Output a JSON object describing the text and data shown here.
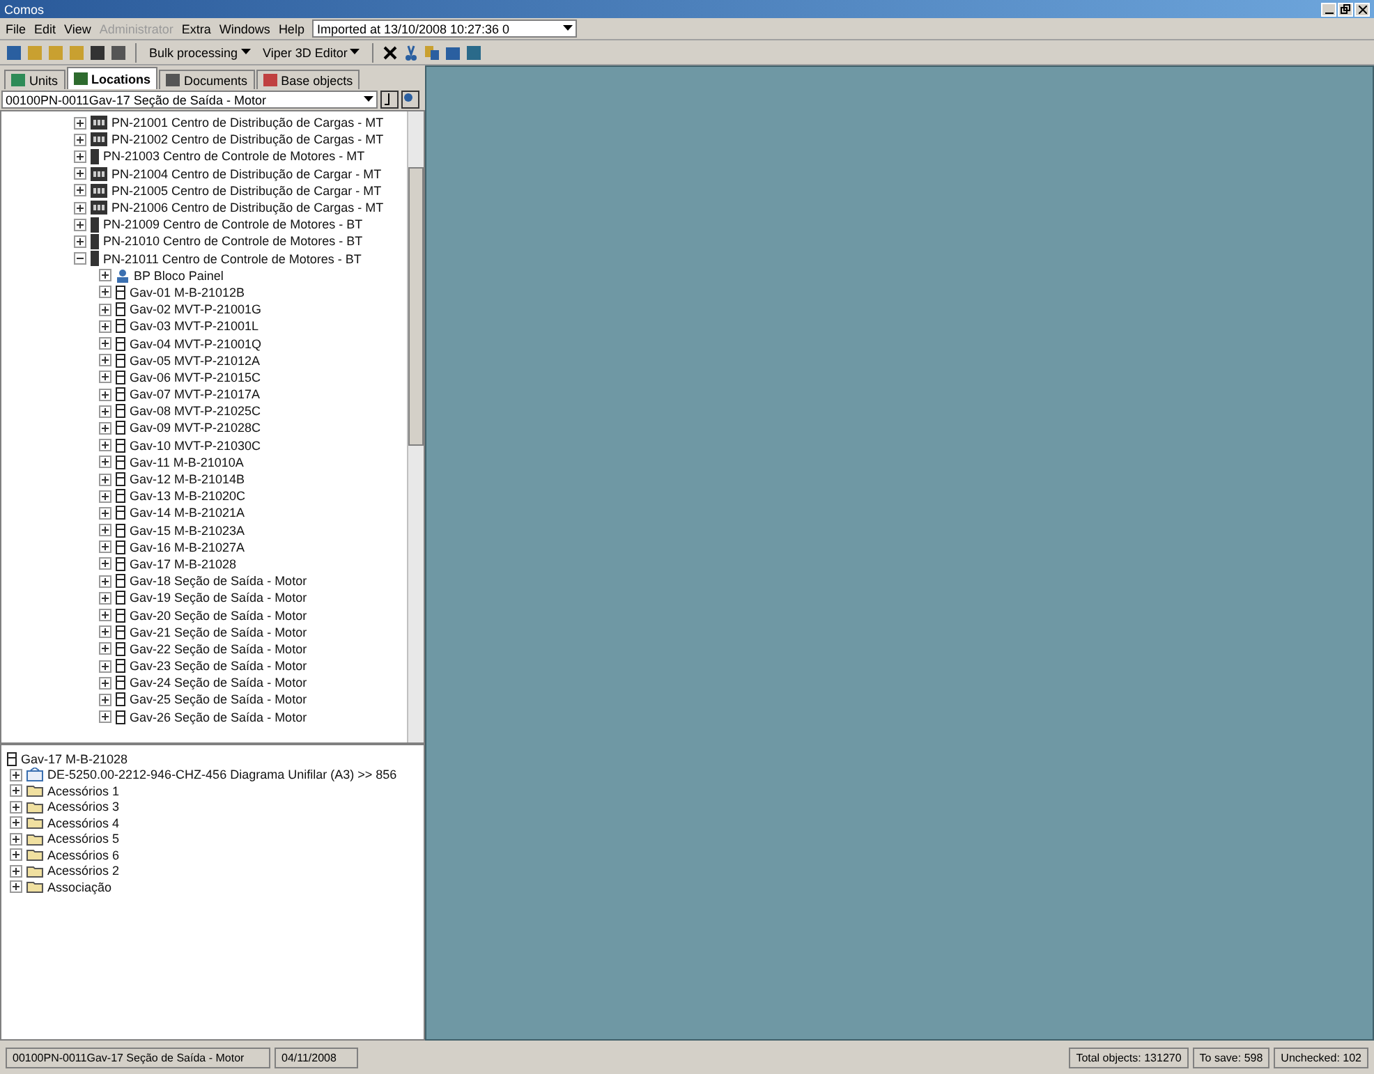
{
  "window": {
    "title": "Comos"
  },
  "menu": [
    {
      "label": "File",
      "disabled": false
    },
    {
      "label": "Edit",
      "disabled": false
    },
    {
      "label": "View",
      "disabled": false
    },
    {
      "label": "Administrator",
      "disabled": true
    },
    {
      "label": "Extra",
      "disabled": false
    },
    {
      "label": "Windows",
      "disabled": false
    },
    {
      "label": "Help",
      "disabled": false
    }
  ],
  "import_selector": {
    "value": "Imported at 13/10/2008 10:27:36  0"
  },
  "toolbar": {
    "buttons": [
      "Bulk processing",
      "Viper 3D Editor"
    ]
  },
  "tabs": [
    {
      "label": "Units",
      "selected": false
    },
    {
      "label": "Locations",
      "selected": true
    },
    {
      "label": "Documents",
      "selected": false
    },
    {
      "label": "Base objects",
      "selected": false
    }
  ],
  "location_selector": {
    "value": "00100PN-0011Gav-17  Seção de Saída - Motor"
  },
  "tree": [
    {
      "kind": "board",
      "label": "PN-21001 Centro de Distribução de Cargas - MT",
      "expanded": false
    },
    {
      "kind": "board",
      "label": "PN-21002 Centro de Distribução de Cargas - MT",
      "expanded": false
    },
    {
      "kind": "cabinet",
      "label": "PN-21003 Centro de Controle de Motores - MT",
      "expanded": false
    },
    {
      "kind": "board",
      "label": "PN-21004 Centro de Distribução de Cargar - MT",
      "expanded": false
    },
    {
      "kind": "board",
      "label": "PN-21005 Centro de Distribução de Cargar - MT",
      "expanded": false
    },
    {
      "kind": "board",
      "label": "PN-21006 Centro de Distribução de Cargas - MT",
      "expanded": false
    },
    {
      "kind": "cabinet",
      "label": "PN-21009 Centro de Controle de Motores - BT",
      "expanded": false
    },
    {
      "kind": "cabinet",
      "label": "PN-21010 Centro de Controle de Motores - BT",
      "expanded": false
    },
    {
      "kind": "cabinet",
      "label": "PN-21011 Centro de Controle de Motores - BT",
      "expanded": true,
      "children": [
        {
          "kind": "panel",
          "label": "BP   Bloco Painel",
          "expanded": false
        },
        {
          "kind": "drawer",
          "label": "Gav-01   M-B-21012B",
          "expanded": false
        },
        {
          "kind": "drawer",
          "label": "Gav-02   MVT-P-21001G",
          "expanded": false
        },
        {
          "kind": "drawer",
          "label": "Gav-03   MVT-P-21001L",
          "expanded": false
        },
        {
          "kind": "drawer",
          "label": "Gav-04   MVT-P-21001Q",
          "expanded": false
        },
        {
          "kind": "drawer",
          "label": "Gav-05   MVT-P-21012A",
          "expanded": false
        },
        {
          "kind": "drawer",
          "label": "Gav-06   MVT-P-21015C",
          "expanded": false
        },
        {
          "kind": "drawer",
          "label": "Gav-07   MVT-P-21017A",
          "expanded": false
        },
        {
          "kind": "drawer",
          "label": "Gav-08   MVT-P-21025C",
          "expanded": false
        },
        {
          "kind": "drawer",
          "label": "Gav-09   MVT-P-21028C",
          "expanded": false
        },
        {
          "kind": "drawer",
          "label": "Gav-10   MVT-P-21030C",
          "expanded": false
        },
        {
          "kind": "drawer",
          "label": "Gav-11   M-B-21010A",
          "expanded": false
        },
        {
          "kind": "drawer",
          "label": "Gav-12   M-B-21014B",
          "expanded": false
        },
        {
          "kind": "drawer",
          "label": "Gav-13   M-B-21020C",
          "expanded": false
        },
        {
          "kind": "drawer",
          "label": "Gav-14   M-B-21021A",
          "expanded": false
        },
        {
          "kind": "drawer",
          "label": "Gav-15   M-B-21023A",
          "expanded": false
        },
        {
          "kind": "drawer",
          "label": "Gav-16   M-B-21027A",
          "expanded": false
        },
        {
          "kind": "drawer",
          "label": "Gav-17   M-B-21028",
          "expanded": false
        },
        {
          "kind": "drawer",
          "label": "Gav-18   Seção de Saída - Motor",
          "expanded": false
        },
        {
          "kind": "drawer",
          "label": "Gav-19   Seção de Saída - Motor",
          "expanded": false
        },
        {
          "kind": "drawer",
          "label": "Gav-20   Seção de Saída - Motor",
          "expanded": false
        },
        {
          "kind": "drawer",
          "label": "Gav-21   Seção de Saída - Motor",
          "expanded": false
        },
        {
          "kind": "drawer",
          "label": "Gav-22   Seção de Saída - Motor",
          "expanded": false
        },
        {
          "kind": "drawer",
          "label": "Gav-23   Seção de Saída - Motor",
          "expanded": false
        },
        {
          "kind": "drawer",
          "label": "Gav-24   Seção de Saída - Motor",
          "expanded": false
        },
        {
          "kind": "drawer",
          "label": "Gav-25   Seção de Saída - Motor",
          "expanded": false
        },
        {
          "kind": "drawer",
          "label": "Gav-26   Seção de Saída - Motor",
          "expanded": false
        }
      ]
    }
  ],
  "detail": {
    "title": "Gav-17   M-B-21028",
    "items": [
      {
        "kind": "document",
        "label": "DE-5250.00-2212-946-CHZ-456   Diagrama Unifilar (A3) >> 856"
      },
      {
        "kind": "folder",
        "label": "Acessórios 1"
      },
      {
        "kind": "folder",
        "label": "Acessórios 3"
      },
      {
        "kind": "folder",
        "label": "Acessórios 4"
      },
      {
        "kind": "folder",
        "label": "Acessórios 5"
      },
      {
        "kind": "folder",
        "label": "Acessórios 6"
      },
      {
        "kind": "folder",
        "label": "Acessórios 2"
      },
      {
        "kind": "folder",
        "label": "Associação"
      }
    ]
  },
  "status_bar": {
    "location": "00100PN-0011Gav-17   Seção de Saída - Motor",
    "date": "04/11/2008",
    "total": "Total objects: 131270",
    "to_save": "To save: 598",
    "unchecked": "Unchecked: 102"
  }
}
